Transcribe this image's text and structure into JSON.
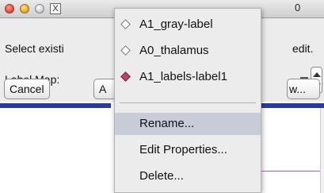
{
  "dialog": {
    "title_fragment": "0",
    "prompt_text": "Select existi",
    "prompt_tail": "edit.",
    "label_map_label": "Label Map:",
    "window_x_button": "X",
    "buttons": {
      "cancel": "Cancel",
      "partial_a": "A",
      "partial_new": "w..."
    }
  },
  "menu": {
    "items": [
      {
        "label": "A1_gray-label",
        "selected": false
      },
      {
        "label": "A0_thalamus",
        "selected": false
      },
      {
        "label": "A1_labels-label1",
        "selected": true
      }
    ],
    "actions": [
      {
        "label": "Rename...",
        "highlighted": true
      },
      {
        "label": "Edit Properties...",
        "highlighted": false
      },
      {
        "label": "Delete...",
        "highlighted": false
      }
    ]
  },
  "colors": {
    "selected_diamond": "#b8416f",
    "highlight": "#c7ccd8",
    "view_strip": "#2a3b9c",
    "crosshair": "#d84ad8"
  }
}
